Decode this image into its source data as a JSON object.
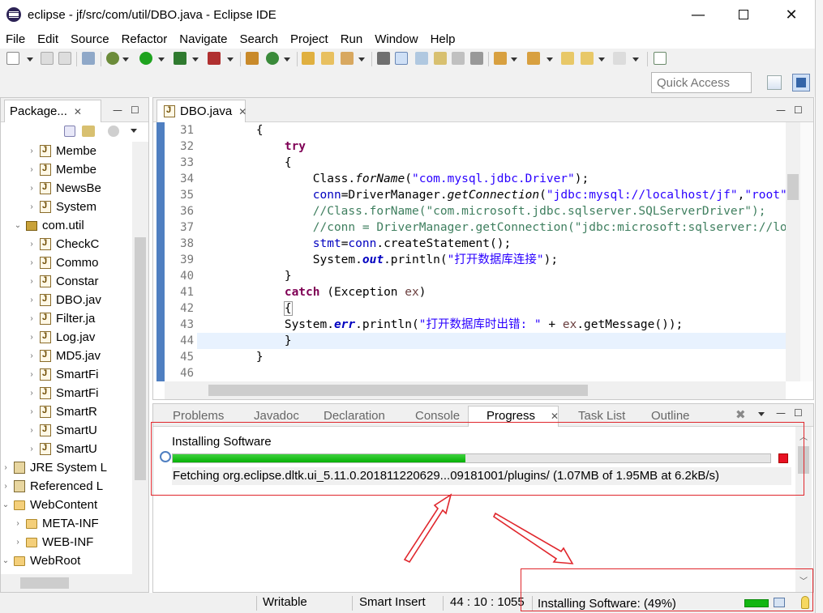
{
  "window": {
    "title": "eclipse - jf/src/com/util/DBO.java - Eclipse IDE",
    "min_glyph": "—",
    "close_glyph": "✕"
  },
  "menu": [
    "File",
    "Edit",
    "Source",
    "Refactor",
    "Navigate",
    "Search",
    "Project",
    "Run",
    "Window",
    "Help"
  ],
  "toolbar": {
    "quick_access_placeholder": "Quick Access"
  },
  "package_explorer": {
    "tab_label": "Package...",
    "tree": [
      {
        "label": "Membe",
        "icon": "java",
        "indent": 4,
        "arrow": "›"
      },
      {
        "label": "Membe",
        "icon": "java",
        "indent": 4,
        "arrow": "›"
      },
      {
        "label": "NewsBe",
        "icon": "java",
        "indent": 4,
        "arrow": "›"
      },
      {
        "label": "System",
        "icon": "java",
        "indent": 4,
        "arrow": "›"
      },
      {
        "label": "com.util",
        "icon": "pkg",
        "indent": 3,
        "arrow": "⌄"
      },
      {
        "label": "CheckC",
        "icon": "java",
        "indent": 4,
        "arrow": "›"
      },
      {
        "label": "Commo",
        "icon": "java",
        "indent": 4,
        "arrow": "›"
      },
      {
        "label": "Constar",
        "icon": "java",
        "indent": 4,
        "arrow": "›"
      },
      {
        "label": "DBO.jav",
        "icon": "java",
        "indent": 4,
        "arrow": "›"
      },
      {
        "label": "Filter.ja",
        "icon": "java",
        "indent": 4,
        "arrow": "›"
      },
      {
        "label": "Log.jav",
        "icon": "java",
        "indent": 4,
        "arrow": "›"
      },
      {
        "label": "MD5.jav",
        "icon": "java",
        "indent": 4,
        "arrow": "›"
      },
      {
        "label": "SmartFi",
        "icon": "java",
        "indent": 4,
        "arrow": "›"
      },
      {
        "label": "SmartFi",
        "icon": "java",
        "indent": 4,
        "arrow": "›"
      },
      {
        "label": "SmartR",
        "icon": "java",
        "indent": 4,
        "arrow": "›"
      },
      {
        "label": "SmartU",
        "icon": "java",
        "indent": 4,
        "arrow": "›"
      },
      {
        "label": "SmartU",
        "icon": "java",
        "indent": 4,
        "arrow": "›"
      },
      {
        "label": "JRE System L",
        "icon": "lib",
        "indent": 2,
        "arrow": "›"
      },
      {
        "label": "Referenced L",
        "icon": "lib",
        "indent": 2,
        "arrow": "›"
      },
      {
        "label": "WebContent",
        "icon": "folder",
        "indent": 2,
        "arrow": "⌄"
      },
      {
        "label": "META-INF",
        "icon": "folder",
        "indent": 3,
        "arrow": "›"
      },
      {
        "label": "WEB-INF",
        "icon": "folder",
        "indent": 3,
        "arrow": "›"
      },
      {
        "label": "WebRoot",
        "icon": "folder",
        "indent": 2,
        "arrow": "⌄"
      }
    ]
  },
  "editor": {
    "tab_label": "DBO.java",
    "line_numbers": [
      "31",
      "32",
      "33",
      "34",
      "35",
      "36",
      "37",
      "38",
      "39",
      "40",
      "41",
      "42",
      "43",
      "44",
      "45",
      "46"
    ],
    "current_line_index": 13
  },
  "bottom_panel": {
    "tabs": [
      "Problems",
      "Javadoc",
      "Declaration",
      "Console",
      "Progress",
      "Task List",
      "Outline"
    ],
    "active_tab": "Progress",
    "job_name": "Installing Software",
    "job_detail": "Fetching org.eclipse.dltk.ui_5.11.0.201811220629...09181001/plugins/ (1.07MB of 1.95MB at 6.2kB/s)",
    "progress_fraction": 0.49
  },
  "status_bar": {
    "mode": "Writable",
    "insert_mode": "Smart Insert",
    "cursor": "44 : 10 : 1055",
    "background_job": "Installing Software: (49%)"
  },
  "colors": {
    "annotation_red": "#e0262c",
    "progress_green": "#06b006",
    "keyword": "#7f0055",
    "string": "#2a00ff",
    "comment": "#3f7f5f"
  }
}
